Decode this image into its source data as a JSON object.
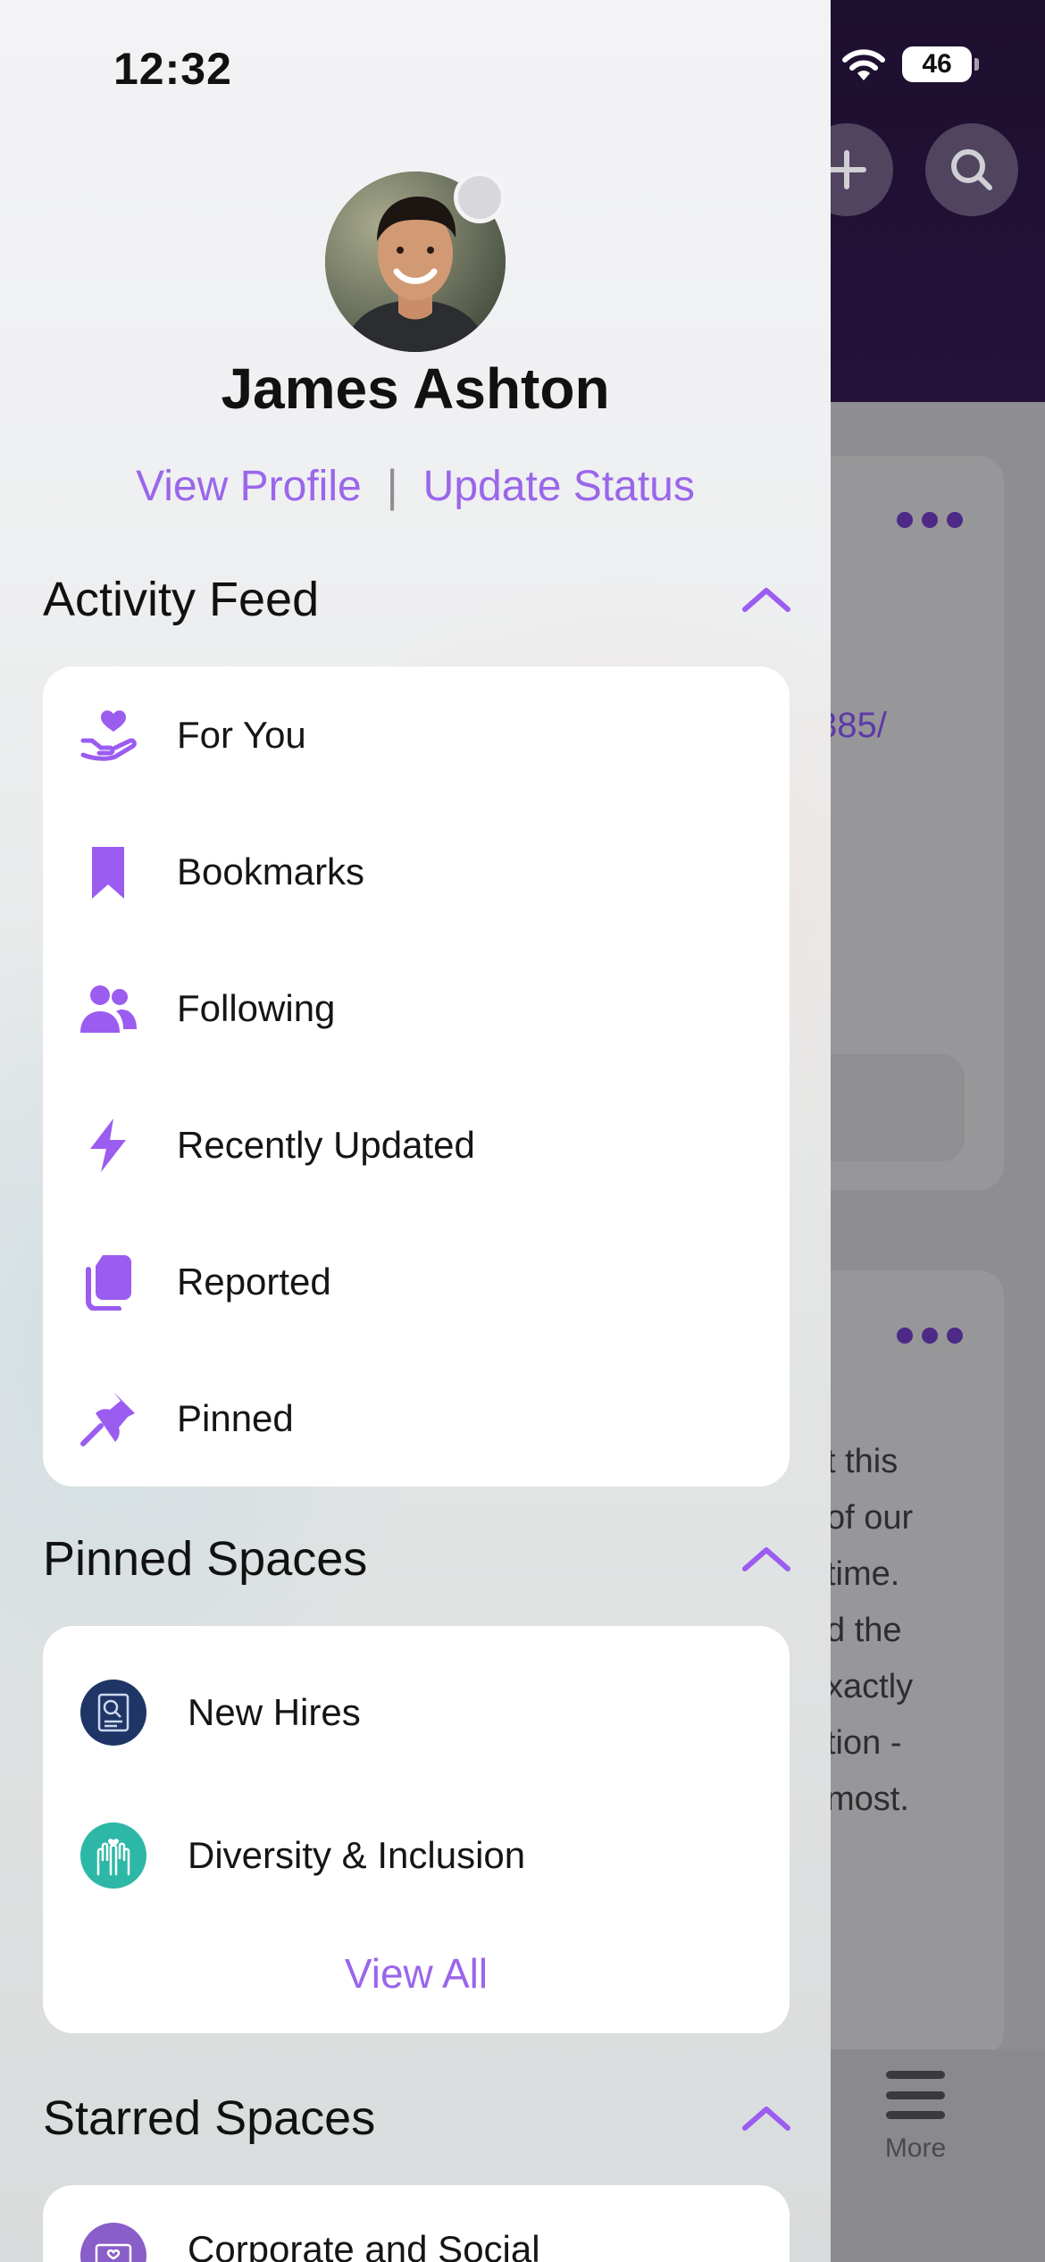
{
  "status_bar": {
    "time": "12:32",
    "battery": "46"
  },
  "profile": {
    "name": "James Ashton",
    "view_profile": "View Profile",
    "separator": "|",
    "update_status": "Update Status"
  },
  "activity_feed": {
    "title": "Activity Feed",
    "items": [
      {
        "label": "For You",
        "icon": "heart-hand-icon"
      },
      {
        "label": "Bookmarks",
        "icon": "bookmark-icon"
      },
      {
        "label": "Following",
        "icon": "people-icon"
      },
      {
        "label": "Recently Updated",
        "icon": "lightning-icon"
      },
      {
        "label": "Reported",
        "icon": "documents-icon"
      },
      {
        "label": "Pinned",
        "icon": "pushpin-icon"
      }
    ]
  },
  "pinned_spaces": {
    "title": "Pinned Spaces",
    "items": [
      {
        "label": "New Hires",
        "icon": "new-hires-space-icon",
        "color": "#1f3566"
      },
      {
        "label": "Diversity & Inclusion",
        "icon": "diversity-space-icon",
        "color": "#2db7a6"
      }
    ],
    "view_all": "View All"
  },
  "starred_spaces": {
    "title": "Starred Spaces",
    "items": [
      {
        "label": "Corporate and Social",
        "icon": "heart-envelope-icon",
        "color": "#8a5ec9"
      }
    ]
  },
  "background": {
    "link_fragment": "385/",
    "post_text": "t this\nof our\n time.\nd the\nxactly\ntion -\n most.",
    "more_tab_label": "More"
  },
  "colors": {
    "accent": "#9a66ea",
    "icon_purple": "#9b5cf0"
  }
}
